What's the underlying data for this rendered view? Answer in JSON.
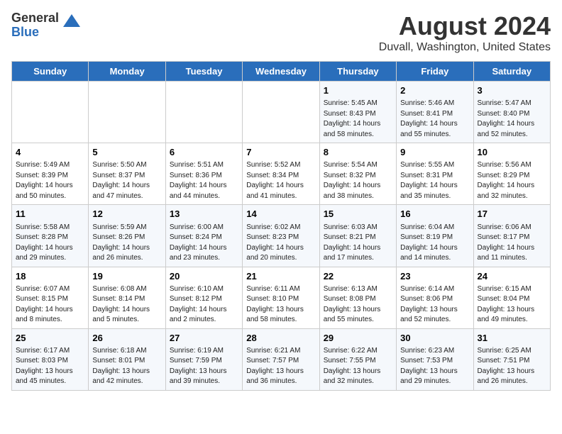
{
  "logo": {
    "general": "General",
    "blue": "Blue"
  },
  "title": "August 2024",
  "subtitle": "Duvall, Washington, United States",
  "days_of_week": [
    "Sunday",
    "Monday",
    "Tuesday",
    "Wednesday",
    "Thursday",
    "Friday",
    "Saturday"
  ],
  "weeks": [
    [
      {
        "day": "",
        "info": ""
      },
      {
        "day": "",
        "info": ""
      },
      {
        "day": "",
        "info": ""
      },
      {
        "day": "",
        "info": ""
      },
      {
        "day": "1",
        "info": "Sunrise: 5:45 AM\nSunset: 8:43 PM\nDaylight: 14 hours\nand 58 minutes."
      },
      {
        "day": "2",
        "info": "Sunrise: 5:46 AM\nSunset: 8:41 PM\nDaylight: 14 hours\nand 55 minutes."
      },
      {
        "day": "3",
        "info": "Sunrise: 5:47 AM\nSunset: 8:40 PM\nDaylight: 14 hours\nand 52 minutes."
      }
    ],
    [
      {
        "day": "4",
        "info": "Sunrise: 5:49 AM\nSunset: 8:39 PM\nDaylight: 14 hours\nand 50 minutes."
      },
      {
        "day": "5",
        "info": "Sunrise: 5:50 AM\nSunset: 8:37 PM\nDaylight: 14 hours\nand 47 minutes."
      },
      {
        "day": "6",
        "info": "Sunrise: 5:51 AM\nSunset: 8:36 PM\nDaylight: 14 hours\nand 44 minutes."
      },
      {
        "day": "7",
        "info": "Sunrise: 5:52 AM\nSunset: 8:34 PM\nDaylight: 14 hours\nand 41 minutes."
      },
      {
        "day": "8",
        "info": "Sunrise: 5:54 AM\nSunset: 8:32 PM\nDaylight: 14 hours\nand 38 minutes."
      },
      {
        "day": "9",
        "info": "Sunrise: 5:55 AM\nSunset: 8:31 PM\nDaylight: 14 hours\nand 35 minutes."
      },
      {
        "day": "10",
        "info": "Sunrise: 5:56 AM\nSunset: 8:29 PM\nDaylight: 14 hours\nand 32 minutes."
      }
    ],
    [
      {
        "day": "11",
        "info": "Sunrise: 5:58 AM\nSunset: 8:28 PM\nDaylight: 14 hours\nand 29 minutes."
      },
      {
        "day": "12",
        "info": "Sunrise: 5:59 AM\nSunset: 8:26 PM\nDaylight: 14 hours\nand 26 minutes."
      },
      {
        "day": "13",
        "info": "Sunrise: 6:00 AM\nSunset: 8:24 PM\nDaylight: 14 hours\nand 23 minutes."
      },
      {
        "day": "14",
        "info": "Sunrise: 6:02 AM\nSunset: 8:23 PM\nDaylight: 14 hours\nand 20 minutes."
      },
      {
        "day": "15",
        "info": "Sunrise: 6:03 AM\nSunset: 8:21 PM\nDaylight: 14 hours\nand 17 minutes."
      },
      {
        "day": "16",
        "info": "Sunrise: 6:04 AM\nSunset: 8:19 PM\nDaylight: 14 hours\nand 14 minutes."
      },
      {
        "day": "17",
        "info": "Sunrise: 6:06 AM\nSunset: 8:17 PM\nDaylight: 14 hours\nand 11 minutes."
      }
    ],
    [
      {
        "day": "18",
        "info": "Sunrise: 6:07 AM\nSunset: 8:15 PM\nDaylight: 14 hours\nand 8 minutes."
      },
      {
        "day": "19",
        "info": "Sunrise: 6:08 AM\nSunset: 8:14 PM\nDaylight: 14 hours\nand 5 minutes."
      },
      {
        "day": "20",
        "info": "Sunrise: 6:10 AM\nSunset: 8:12 PM\nDaylight: 14 hours\nand 2 minutes."
      },
      {
        "day": "21",
        "info": "Sunrise: 6:11 AM\nSunset: 8:10 PM\nDaylight: 13 hours\nand 58 minutes."
      },
      {
        "day": "22",
        "info": "Sunrise: 6:13 AM\nSunset: 8:08 PM\nDaylight: 13 hours\nand 55 minutes."
      },
      {
        "day": "23",
        "info": "Sunrise: 6:14 AM\nSunset: 8:06 PM\nDaylight: 13 hours\nand 52 minutes."
      },
      {
        "day": "24",
        "info": "Sunrise: 6:15 AM\nSunset: 8:04 PM\nDaylight: 13 hours\nand 49 minutes."
      }
    ],
    [
      {
        "day": "25",
        "info": "Sunrise: 6:17 AM\nSunset: 8:03 PM\nDaylight: 13 hours\nand 45 minutes."
      },
      {
        "day": "26",
        "info": "Sunrise: 6:18 AM\nSunset: 8:01 PM\nDaylight: 13 hours\nand 42 minutes."
      },
      {
        "day": "27",
        "info": "Sunrise: 6:19 AM\nSunset: 7:59 PM\nDaylight: 13 hours\nand 39 minutes."
      },
      {
        "day": "28",
        "info": "Sunrise: 6:21 AM\nSunset: 7:57 PM\nDaylight: 13 hours\nand 36 minutes."
      },
      {
        "day": "29",
        "info": "Sunrise: 6:22 AM\nSunset: 7:55 PM\nDaylight: 13 hours\nand 32 minutes."
      },
      {
        "day": "30",
        "info": "Sunrise: 6:23 AM\nSunset: 7:53 PM\nDaylight: 13 hours\nand 29 minutes."
      },
      {
        "day": "31",
        "info": "Sunrise: 6:25 AM\nSunset: 7:51 PM\nDaylight: 13 hours\nand 26 minutes."
      }
    ]
  ]
}
